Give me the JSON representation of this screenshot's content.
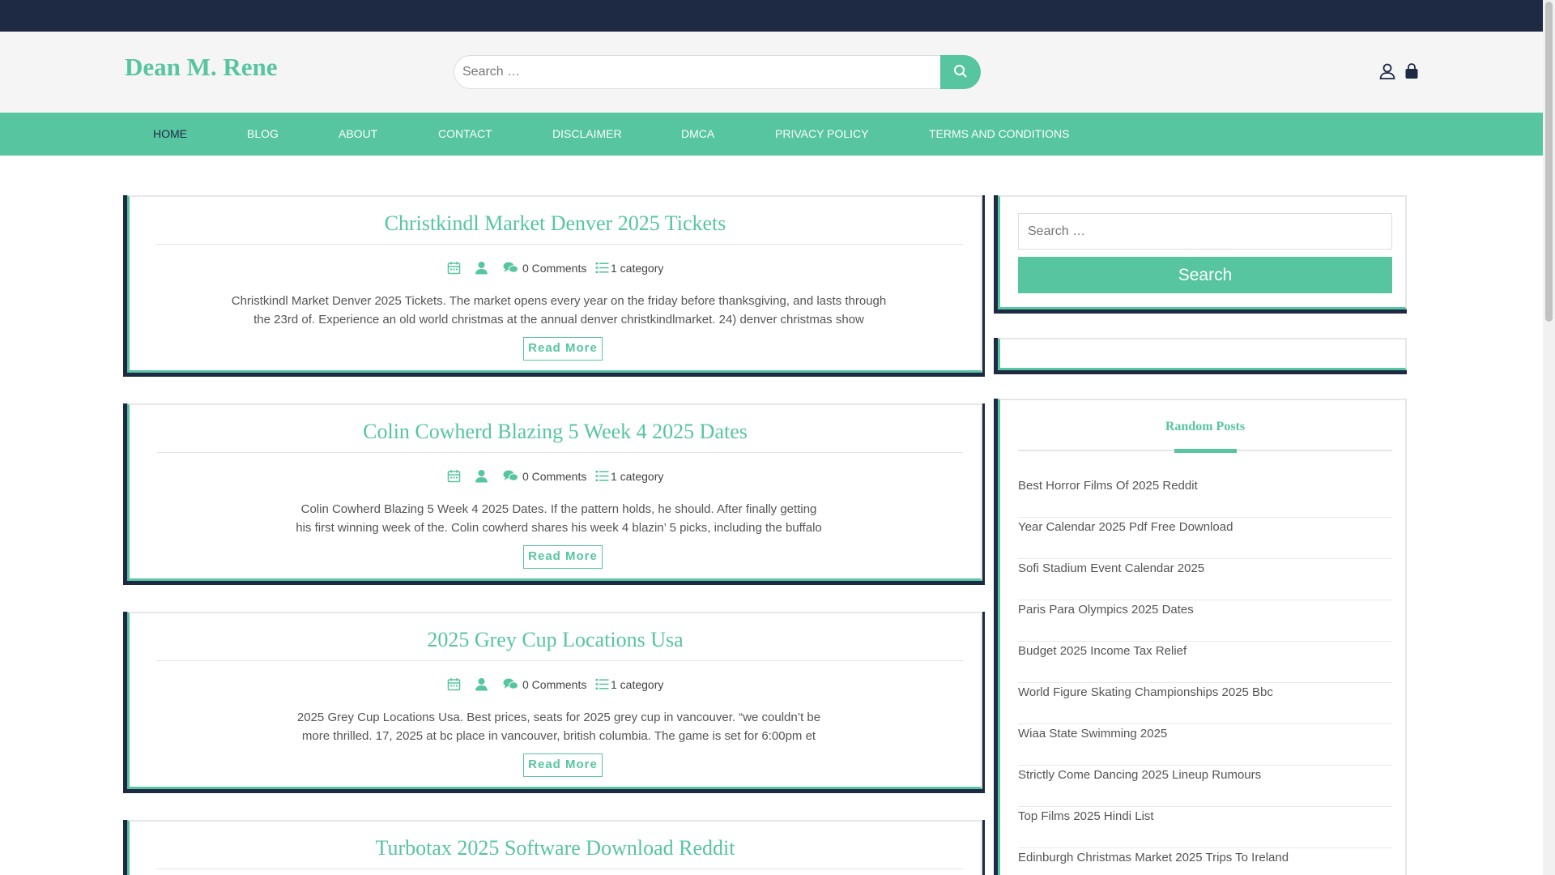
{
  "header": {
    "site_title": "Dean M. Rene",
    "search_placeholder": "Search …",
    "icons": [
      "user-icon",
      "shopping-bag-icon"
    ]
  },
  "nav": {
    "items": [
      "HOME",
      "BLOG",
      "ABOUT",
      "CONTACT",
      "DISCLAIMER",
      "DMCA",
      "PRIVACY POLICY",
      "TERMS AND CONDITIONS"
    ],
    "active": "HOME"
  },
  "posts": [
    {
      "title": "Christkindl Market Denver 2025 Tickets",
      "comments": "0 Comments",
      "category": "1 category",
      "excerpt": "Christkindl Market Denver 2025 Tickets. The market opens every year on the friday before thanksgiving, and lasts through the 23rd of. Experience an old world christmas at the annual denver christkindlmarket. 24) denver christmas show",
      "read_more": "Read More"
    },
    {
      "title": "Colin Cowherd Blazing 5 Week 4 2025 Dates",
      "comments": "0 Comments",
      "category": "1 category",
      "excerpt": "Colin Cowherd Blazing 5 Week 4 2025 Dates. If the pattern holds, he should. After finally getting his first winning week of the. Colin cowherd shares his week 4 blazin’ 5 picks, including the buffalo",
      "read_more": "Read More"
    },
    {
      "title": "2025 Grey Cup Locations Usa",
      "comments": "0 Comments",
      "category": "1 category",
      "excerpt": "2025 Grey Cup Locations Usa. Best prices, seats for 2025 grey cup in vancouver. “we couldn’t be more thrilled. 17, 2025 at bc place in vancouver, british columbia. The game is set for 6:00pm et",
      "read_more": "Read More"
    },
    {
      "title": "Turbotax 2025 Software Download Reddit"
    }
  ],
  "sidebar": {
    "search_placeholder": "Search …",
    "search_button": "Search",
    "random_posts_title": "Random Posts",
    "random_posts": [
      "Best Horror Films Of 2025 Reddit",
      "Year Calendar 2025 Pdf Free Download",
      "Sofi Stadium Event Calendar 2025",
      "Paris Para Olympics 2025 Dates",
      "Budget 2025 Income Tax Relief",
      "World Figure Skating Championships 2025 Bbc",
      "Wiaa State Swimming 2025",
      "Strictly Come Dancing 2025 Lineup Rumours",
      "Top Films 2025 Hindi List",
      "Edinburgh Christmas Market 2025 Trips To Ireland"
    ]
  },
  "colors": {
    "accent": "#56c5a0",
    "navy": "#1e2a44",
    "header_bg": "#f5f5f5"
  }
}
